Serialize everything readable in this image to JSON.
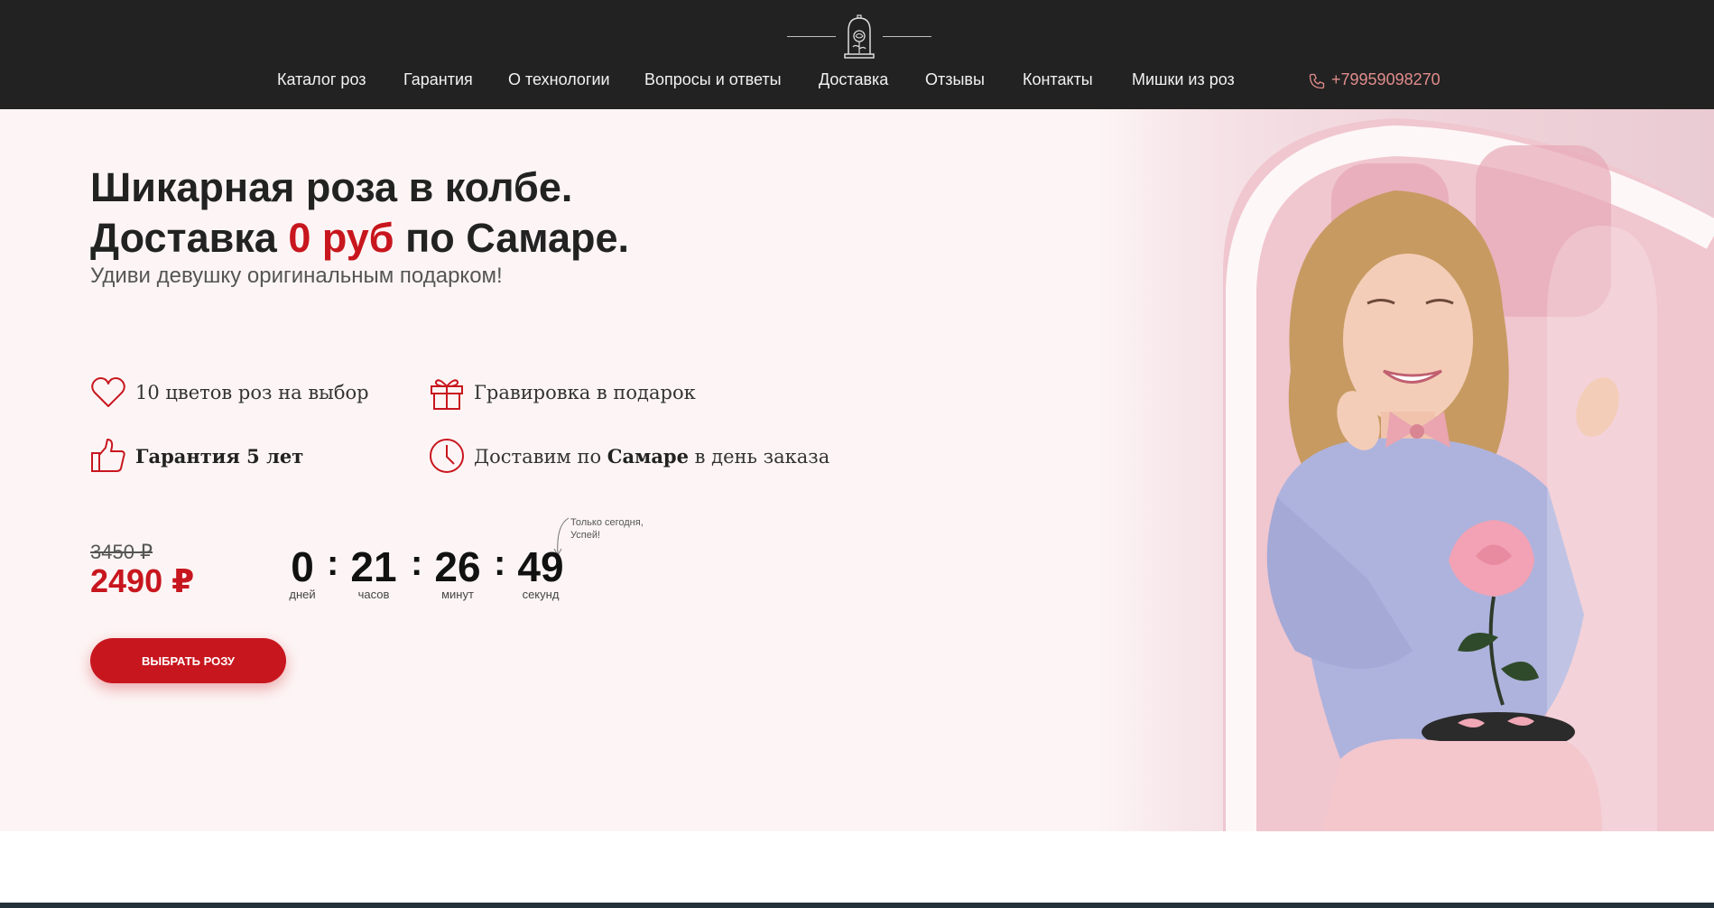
{
  "header": {
    "logo_icon": "rose-in-flask-icon",
    "nav": [
      {
        "label": "Каталог роз"
      },
      {
        "label": "Гарантия"
      },
      {
        "label": "О технологии"
      },
      {
        "label": "Вопросы и ответы"
      },
      {
        "label": "Доставка"
      },
      {
        "label": "Отзывы"
      },
      {
        "label": "Контакты"
      },
      {
        "label": "Мишки из роз"
      }
    ],
    "phone": {
      "icon": "phone-icon",
      "number": "+79959098270"
    }
  },
  "hero": {
    "title_line1": "Шикарная роза в колбе.",
    "title_line2_prefix": "Доставка ",
    "title_line2_highlight": "0 руб",
    "title_line2_suffix": " по Самаре.",
    "subtitle": "Удиви девушку оригинальным подарком!",
    "features": [
      {
        "icon": "heart-icon",
        "text": "10 цветов роз на выбор"
      },
      {
        "icon": "gift-icon",
        "text": "Гравировка в подарок"
      },
      {
        "icon": "thumbs-up-icon",
        "text_bold": "Гарантия 5 лет"
      },
      {
        "icon": "clock-icon",
        "text_prefix": "Доставим по ",
        "text_bold": "Самаре",
        "text_suffix": " в день заказа"
      }
    ],
    "price": {
      "old": "3450 ₽",
      "new": "2490 ₽"
    },
    "countdown": {
      "note": "Только сегодня,\nУспей!",
      "days": "0",
      "days_label": "дней",
      "hours": "21",
      "hours_label": "часов",
      "minutes": "26",
      "minutes_label": "минут",
      "seconds": "49",
      "seconds_label": "секунд",
      "separator": ":"
    },
    "cta_label": "ВЫБРАТЬ РОЗУ"
  },
  "colors": {
    "accent": "#c8161e",
    "header_bg": "#222222",
    "hero_bg": "#fdf5f5",
    "phone": "#e28c8c"
  }
}
